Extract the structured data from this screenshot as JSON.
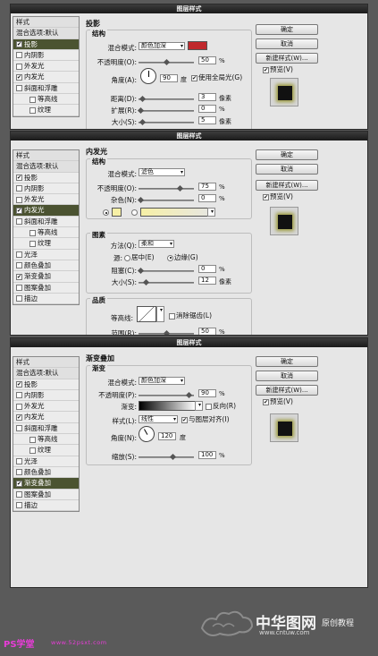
{
  "dialog_title": "图层样式",
  "buttons": {
    "ok": "确定",
    "cancel": "取消",
    "new_style": "新建样式(W)...",
    "preview": "预览(V)"
  },
  "nav_items": [
    "样式",
    "混合选项:默认",
    "投影",
    "内阴影",
    "外发光",
    "内发光",
    "斜面和浮雕",
    "等高线",
    "纹理",
    "光泽",
    "颜色叠加",
    "渐变叠加",
    "图案叠加",
    "描边"
  ],
  "d1": {
    "panel": "投影",
    "group": "结构",
    "blend_label": "混合模式:",
    "blend": "颜色加深",
    "color": "#c0282c",
    "opacity_label": "不透明度(O):",
    "opacity": "50",
    "pct": "%",
    "angle_label": "角度(A):",
    "angle": "90",
    "deg": "度",
    "global_light": "使用全局光(G)",
    "distance_label": "距离(D):",
    "distance": "3",
    "px": "像素",
    "spread_label": "扩展(R):",
    "spread": "0",
    "size_label": "大小(S):",
    "size": "5"
  },
  "d2": {
    "panel": "内发光",
    "group": "结构",
    "blend_label": "混合模式:",
    "blend": "滤色",
    "opacity_label": "不透明度(O):",
    "opacity": "75",
    "noise_label": "杂色(N):",
    "noise": "0",
    "pct": "%",
    "color": "#f7f0a6",
    "elements_group": "图素",
    "method_label": "方法(Q):",
    "method": "柔和",
    "source_label": "源:",
    "center": "居中(E)",
    "edge": "边缘(G)",
    "choke_label": "阻塞(C):",
    "choke": "0",
    "size_label": "大小(S):",
    "size": "12",
    "px": "像素",
    "quality_group": "品质",
    "contour_label": "等高线:",
    "antialias": "消除锯齿(L)",
    "range_label": "范围(R):",
    "range": "50"
  },
  "d3": {
    "panel": "渐变叠加",
    "group": "渐变",
    "blend_label": "混合模式:",
    "blend": "颜色加深",
    "opacity_label": "不透明度(P):",
    "opacity": "90",
    "pct": "%",
    "gradient_label": "渐变:",
    "reverse": "反向(R)",
    "style_label": "样式(L):",
    "style": "线性",
    "align": "与图层对齐(I)",
    "angle_label": "角度(N):",
    "angle": "120",
    "deg": "度",
    "scale_label": "缩放(S):",
    "scale": "100"
  },
  "footer": {
    "ps": "PS学堂",
    "site": "www.52psxt.com",
    "brand": "中华图网",
    "brand_sub": "原创教程",
    "url": "www.cntuw.com"
  }
}
